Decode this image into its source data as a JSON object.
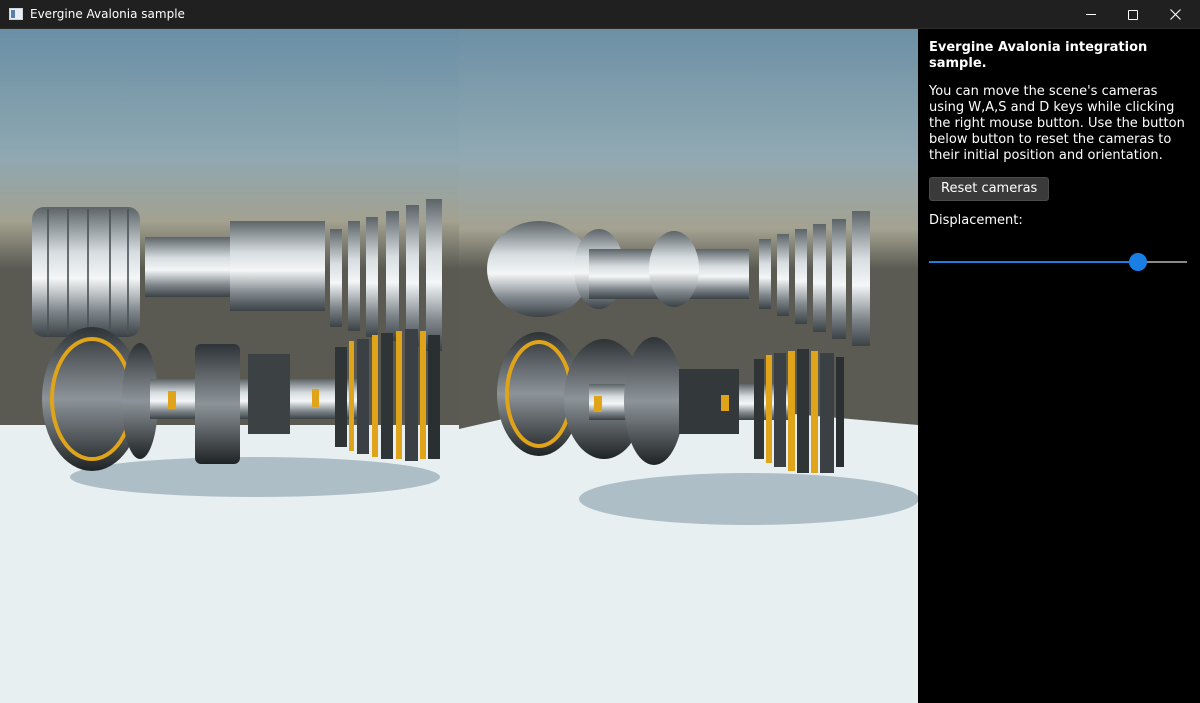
{
  "window": {
    "title": "Evergine Avalonia sample",
    "controls": {
      "minimize": "minimize-icon",
      "maximize": "maximize-icon",
      "close": "close-icon"
    }
  },
  "viewports": [
    {
      "name": "left-camera-view",
      "content": "turbine-engine-exploded-3d"
    },
    {
      "name": "right-camera-view",
      "content": "turbine-engine-exploded-3d"
    }
  ],
  "panel": {
    "title": "Evergine Avalonia integration sample.",
    "description": "You can move the scene's cameras using W,A,S and D keys while clicking the right mouse button. Use the button below button to reset the cameras to their initial position and orientation.",
    "reset_button": "Reset cameras",
    "displacement_label": "Displacement:",
    "displacement_value": 0.81
  },
  "colors": {
    "accent": "#1a7fe4",
    "panel_bg": "#000000",
    "titlebar_bg": "#202020",
    "sky_top": "#6e93a7",
    "floor": "#e6eef0",
    "turbine_accent": "#e0a41a"
  }
}
